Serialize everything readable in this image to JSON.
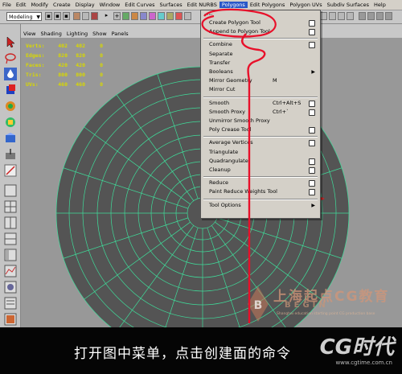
{
  "menubar": {
    "items": [
      "File",
      "Edit",
      "Modify",
      "Create",
      "Display",
      "Window",
      "Edit Curves",
      "Surfaces",
      "Edit NURBS",
      "Polygons",
      "Edit Polygons",
      "Polygon UVs",
      "Subdiv Surfaces",
      "Help"
    ],
    "active_index": 9
  },
  "toolbar": {
    "mode_select": "Modeling"
  },
  "viewport_menu": [
    "View",
    "Shading",
    "Lighting",
    "Show",
    "Panels"
  ],
  "hud": [
    {
      "label": "Verts:",
      "a": "402",
      "b": "402",
      "c": "0"
    },
    {
      "label": "Edges:",
      "a": "820",
      "b": "820",
      "c": "0"
    },
    {
      "label": "Faces:",
      "a": "420",
      "b": "420",
      "c": "0"
    },
    {
      "label": "Tris:",
      "a": "800",
      "b": "800",
      "c": "0"
    },
    {
      "label": "UVs:",
      "a": "460",
      "b": "460",
      "c": "0"
    }
  ],
  "polygons_menu": {
    "items": [
      {
        "label": "Create Polygon Tool",
        "box": true
      },
      {
        "label": "Append to Polygon Tool",
        "box": true
      },
      {
        "sep": true
      },
      {
        "label": "Combine",
        "box": true
      },
      {
        "label": "Separate"
      },
      {
        "label": "Transfer"
      },
      {
        "label": "Booleans",
        "submenu": true
      },
      {
        "label": "Mirror Geometry",
        "shortcut": "M"
      },
      {
        "label": "Mirror Cut"
      },
      {
        "sep": true
      },
      {
        "label": "Smooth",
        "shortcut": "Ctrl+Alt+S",
        "box": true
      },
      {
        "label": "Smooth Proxy",
        "shortcut": "Ctrl+`",
        "box": true
      },
      {
        "label": "Unmirror Smooth Proxy"
      },
      {
        "label": "Poly Crease Tool",
        "box": true
      },
      {
        "sep": true
      },
      {
        "label": "Average Vertices",
        "box": true
      },
      {
        "label": "Triangulate"
      },
      {
        "label": "Quadrangulate",
        "box": true
      },
      {
        "label": "Cleanup",
        "box": true
      },
      {
        "sep": true
      },
      {
        "label": "Reduce",
        "box": true
      },
      {
        "label": "Paint Reduce Weights Tool",
        "box": true
      },
      {
        "sep": true
      },
      {
        "label": "Tool Options",
        "submenu": true
      }
    ]
  },
  "caption": {
    "text": "打开图中菜单，点击创建面的命令"
  },
  "logo": {
    "brand": "CG时代",
    "url": "www.cgtime.com.cn"
  },
  "watermark": {
    "cn": "上海起点CG教育",
    "en": "BEGIN",
    "sub": "Shanghai education starting point CG production base"
  },
  "colors": {
    "wire": "#3fdc9a",
    "mesh_fill": "#545454",
    "menu_bg": "#d4d0c8",
    "highlight": "#2a57c8",
    "annotation": "#e8102a",
    "hud": "#d8d800"
  }
}
